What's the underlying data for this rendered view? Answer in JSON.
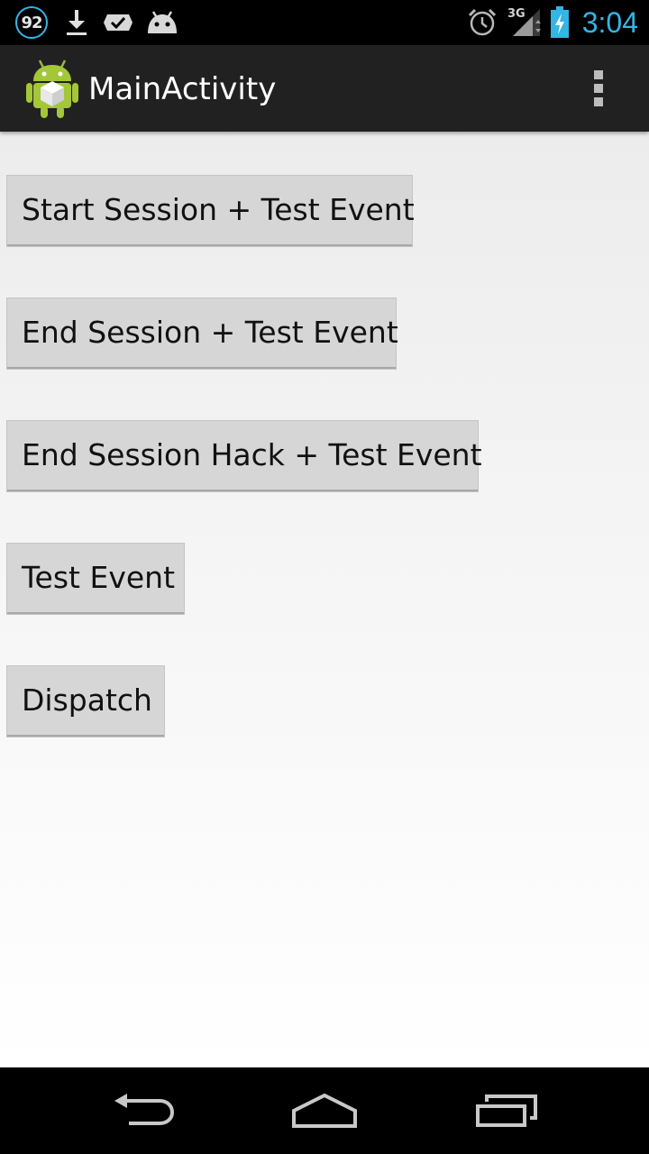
{
  "status_bar": {
    "notification_count": "92",
    "network_type": "3G",
    "time": "3:04",
    "icons": [
      "notification-count-icon",
      "download-icon",
      "task-check-icon",
      "android-debug-icon",
      "alarm-icon",
      "signal-icon",
      "battery-charging-icon"
    ]
  },
  "action_bar": {
    "title": "MainActivity",
    "app_icon": "android-app-icon",
    "menu_icon": "overflow-menu-icon"
  },
  "buttons": {
    "start_session": "Start Session + Test Event",
    "end_session": "End Session + Test Event",
    "end_session_hack": "End Session Hack + Test Event",
    "test_event": "Test Event",
    "dispatch": "Dispatch"
  },
  "nav_bar": {
    "icons": [
      "back-icon",
      "home-icon",
      "recent-apps-icon"
    ]
  },
  "colors": {
    "accent": "#33b5e5",
    "action_bar_bg": "#212121",
    "button_bg": "#d6d6d6"
  }
}
